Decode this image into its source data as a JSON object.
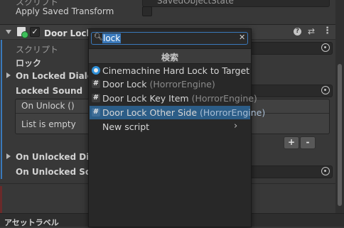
{
  "top": {
    "script_label": "スクリプト",
    "script_value": "SavedObjectState",
    "apply_saved_transform": "Apply Saved Transform"
  },
  "component": {
    "title": "Door Lock Other Side (スクリプト)",
    "script_label": "スクリプト",
    "lock_label": "ロック",
    "on_locked_dialog": "On Locked Dialog",
    "locked_sound": "Locked Sound",
    "on_unlock_header": "On Unlock ()",
    "list_empty": "List is empty",
    "plus": "+",
    "minus": "-",
    "on_unlocked_dialog": "On Unlocked Dialog",
    "on_unlocked_sound": "On Unlocked Sound"
  },
  "footer": {
    "asset_labels": "アセットラベル"
  },
  "popup": {
    "search_value": "lock",
    "header": "検索",
    "items": [
      {
        "label": "Cinemachine Hard Lock to Target",
        "package": "",
        "icon": "cinemachine-icon"
      },
      {
        "label": "Door Lock",
        "package": "(HorrorEngine)",
        "icon": "script-hash-icon"
      },
      {
        "label": "Door Lock Key Item",
        "package": "(HorrorEngine)",
        "icon": "script-hash-icon"
      },
      {
        "label": "Door Lock Other Side",
        "package": "(HorrorEngine)",
        "icon": "script-hash-icon",
        "selected": true
      },
      {
        "label": "New script",
        "package": "",
        "icon": "submenu-chevron-icon"
      }
    ]
  },
  "colors": {
    "selection": "#2c5d87",
    "accent_bar": "#3a79bb",
    "search_border": "#3a79bb"
  }
}
